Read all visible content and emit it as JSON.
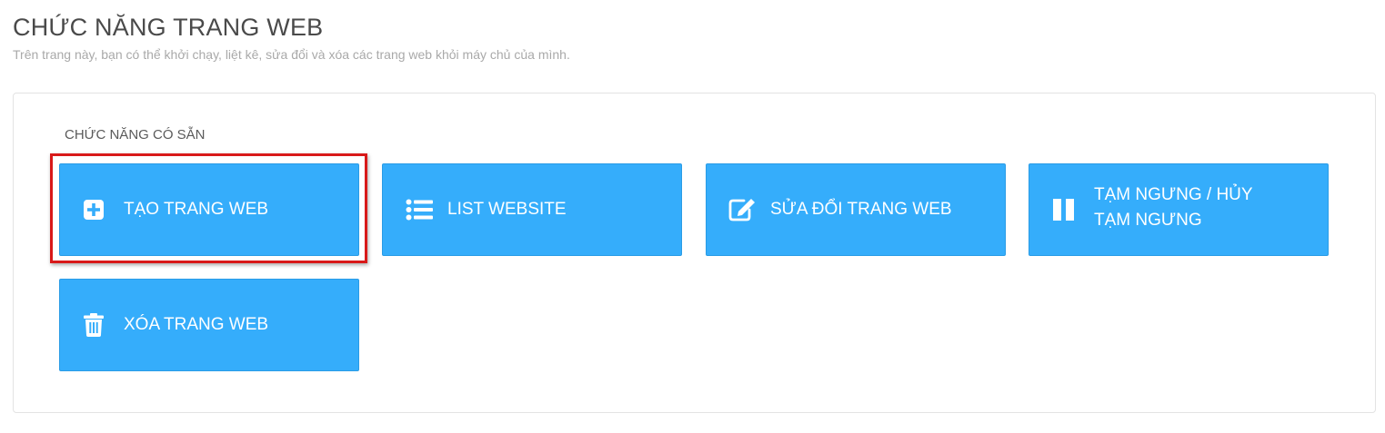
{
  "header": {
    "title": "CHỨC NĂNG TRANG WEB",
    "subtitle": "Trên trang này, bạn có thể khởi chạy, liệt kê, sửa đổi và xóa các trang web khỏi máy chủ của mình."
  },
  "panel": {
    "section_label": "CHỨC NĂNG CÓ SẴN",
    "tiles": [
      {
        "label": "TẠO TRANG WEB",
        "icon": "plus-square-icon",
        "highlighted": true
      },
      {
        "label": "LIST WEBSITE",
        "icon": "list-icon"
      },
      {
        "label": "SỬA ĐỔI TRANG WEB",
        "icon": "edit-icon"
      },
      {
        "label_line1": "TẠM NGƯNG / HỦY",
        "label_line2": "TẠM NGƯNG",
        "icon": "pause-icon"
      },
      {
        "label": "XÓA TRANG WEB",
        "icon": "trash-icon"
      }
    ]
  },
  "colors": {
    "tile_bg": "#35adfb",
    "highlight": "#d81919",
    "title": "#4a4a4a",
    "subtitle": "#a9a9a9"
  }
}
